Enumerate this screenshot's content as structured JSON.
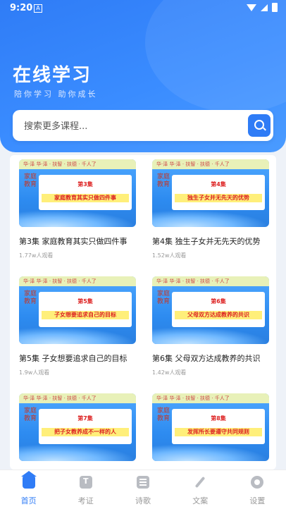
{
  "status": {
    "time": "9:20",
    "notif_glyph": "A"
  },
  "header": {
    "title": "在线学习",
    "subtitle": "陪你学习 助你成长"
  },
  "search": {
    "placeholder": "搜索更多课程..."
  },
  "thumb": {
    "top_strip": "华·泽  华·泽 · 扶智 · 扶德 · 千人了",
    "side_text": "家庭教育",
    "brand": "华夏智业"
  },
  "courses": [
    {
      "episode": "第3集",
      "subject": "家庭教育其实只做四件事",
      "title": "第3集 家庭教育其实只做四件事",
      "views": "1.77w人观看"
    },
    {
      "episode": "第4集",
      "subject": "独生子女并无先天的优势",
      "title": "第4集 独生子女并无先天的优势",
      "views": "1.52w人观看"
    },
    {
      "episode": "第5集",
      "subject": "子女想要追求自己的目标",
      "title": "第5集 子女想要追求自己的目标",
      "views": "1.9w人观看"
    },
    {
      "episode": "第6集",
      "subject": "父母双方达成教养的共识",
      "title": "第6集 父母双方达成教养的共识",
      "views": "1.42w人观看"
    },
    {
      "episode": "第7集",
      "subject": "把子女教养成不一样的人"
    },
    {
      "episode": "第8集",
      "subject": "发挥所长要遵守共同规则"
    }
  ],
  "tabs": [
    {
      "label": "首页",
      "icon": "home-icon",
      "active": true
    },
    {
      "label": "考证",
      "icon": "certificate-icon"
    },
    {
      "label": "诗歌",
      "icon": "book-icon"
    },
    {
      "label": "文案",
      "icon": "brush-icon"
    },
    {
      "label": "设置",
      "icon": "settings-icon"
    }
  ],
  "colors": {
    "accent": "#2f7cf6"
  }
}
